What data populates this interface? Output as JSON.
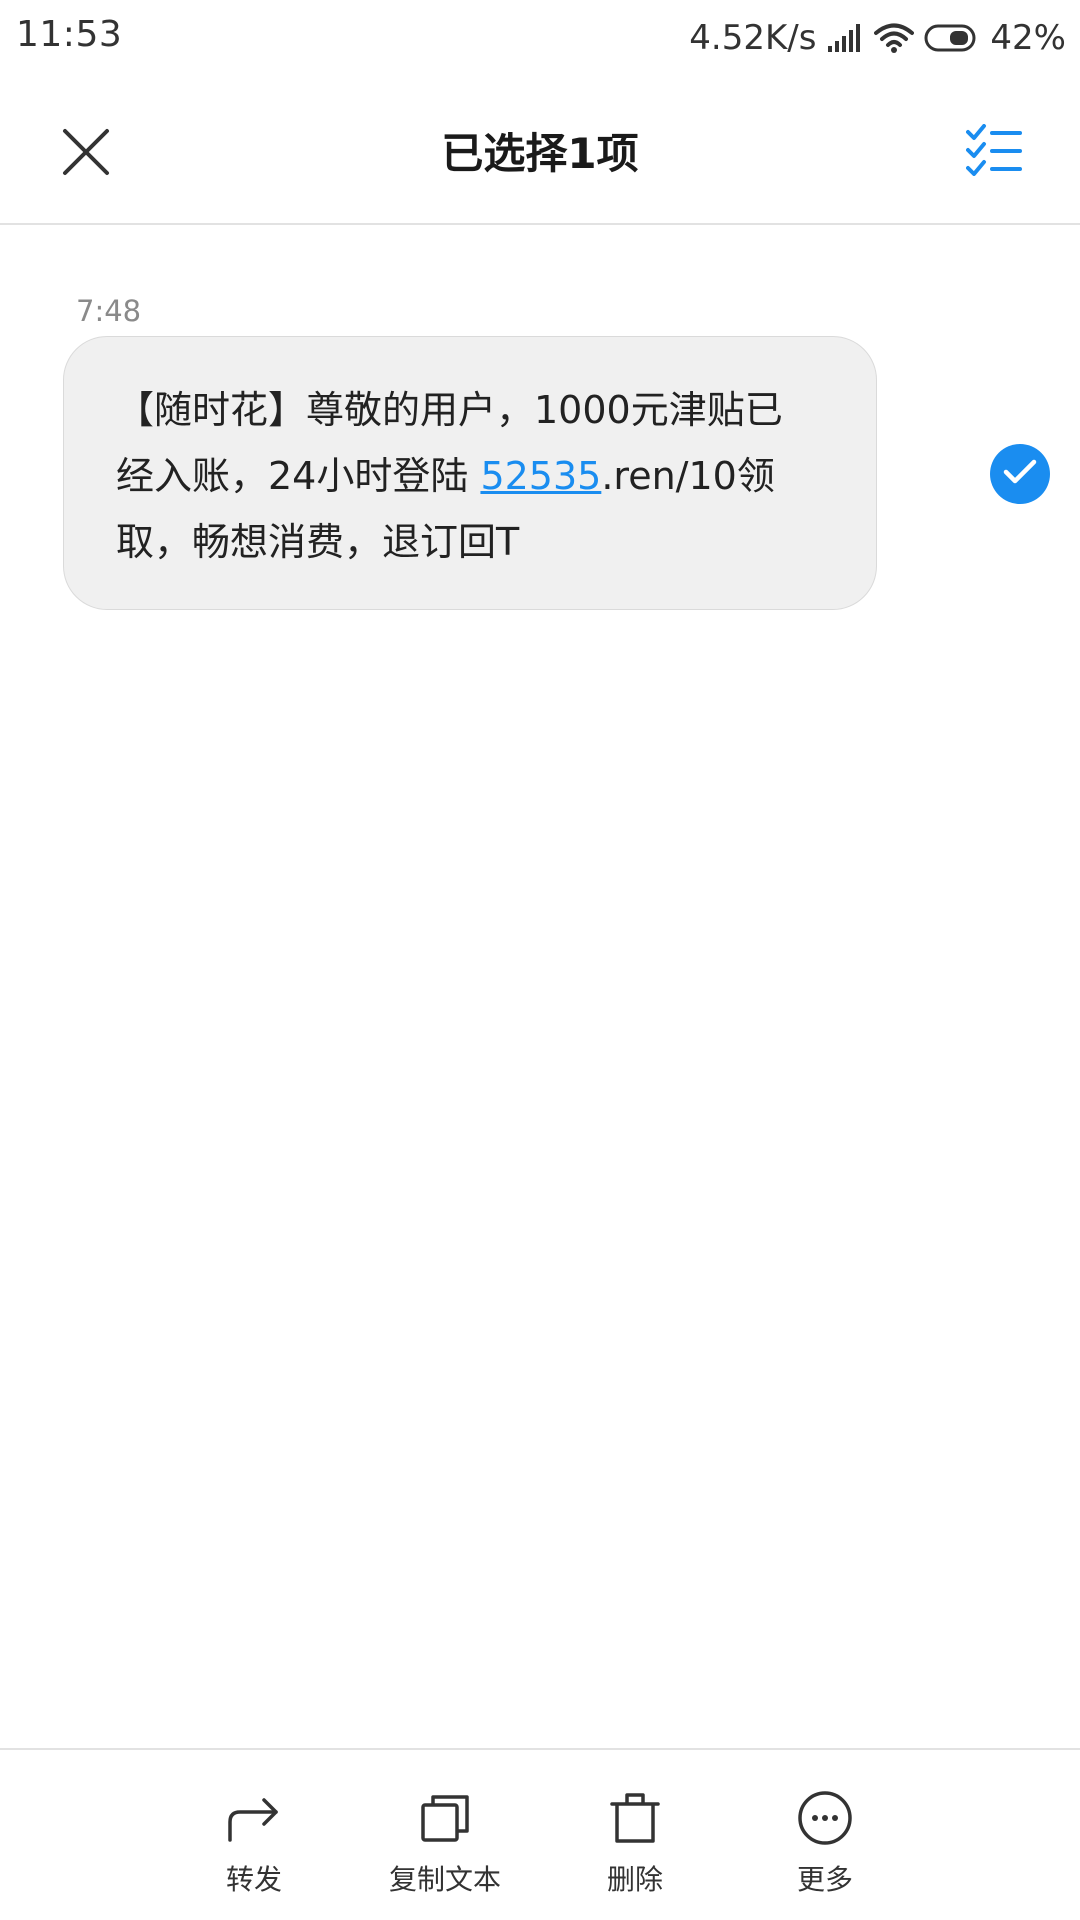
{
  "status_bar": {
    "time": "11:53",
    "network_speed": "4.52K/s",
    "battery": "42%",
    "icons": [
      "signal-icon",
      "wifi-icon",
      "battery-icon"
    ]
  },
  "header": {
    "title": "已选择1项",
    "close_icon": "close-icon",
    "select_all_icon": "select-all-icon"
  },
  "message": {
    "time": "7:48",
    "line1": "【随时花】尊敬的用户，1000元津贴已",
    "line2_before": "经入账，24小时登陆 ",
    "line2_link": "52535",
    "line2_after": ".ren/10领",
    "line3": "取，畅想消费，退订回T",
    "selected": true
  },
  "actions": [
    {
      "label": "转发",
      "icon": "forward-icon"
    },
    {
      "label": "复制文本",
      "icon": "copy-icon"
    },
    {
      "label": "删除",
      "icon": "delete-icon"
    },
    {
      "label": "更多",
      "icon": "more-icon"
    }
  ],
  "colors": {
    "accent": "#1a8df0",
    "bubble_bg": "#f0f0f0",
    "divider": "#e2e2e2",
    "text": "#1a1a1a",
    "muted": "#8a8a8a"
  }
}
